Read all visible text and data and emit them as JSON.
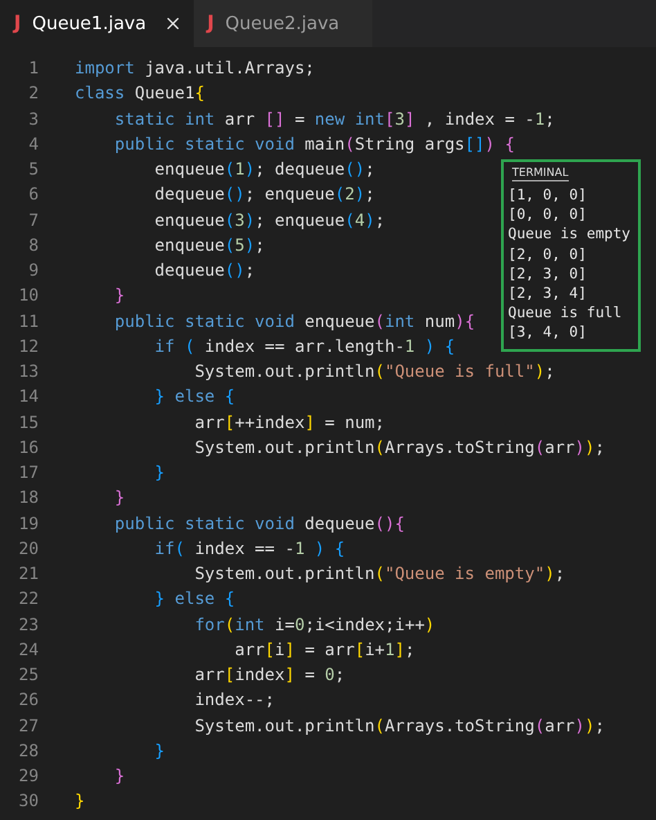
{
  "tabs": [
    {
      "badge": "J",
      "label": "Queue1.java",
      "selected": true
    },
    {
      "badge": "J",
      "label": "Queue2.java",
      "selected": false
    }
  ],
  "editor": {
    "lines": [
      {
        "number": "1",
        "tokens": [
          {
            "text": "import",
            "kind": "kw"
          },
          {
            "text": " java.util.Arrays;",
            "kind": "id"
          }
        ]
      },
      {
        "number": "2",
        "tokens": [
          {
            "text": "class",
            "kind": "kw"
          },
          {
            "text": " Queue1",
            "kind": "id"
          },
          {
            "text": "{",
            "kind": "b1"
          }
        ]
      },
      {
        "number": "3",
        "tokens": [
          {
            "text": "    static int",
            "kind": "kw"
          },
          {
            "text": " arr ",
            "kind": "id"
          },
          {
            "text": "[]",
            "kind": "b2"
          },
          {
            "text": " = ",
            "kind": "id"
          },
          {
            "text": "new int",
            "kind": "kw"
          },
          {
            "text": "[",
            "kind": "b2"
          },
          {
            "text": "3",
            "kind": "num"
          },
          {
            "text": "]",
            "kind": "b2"
          },
          {
            "text": " , index = -",
            "kind": "id"
          },
          {
            "text": "1",
            "kind": "num"
          },
          {
            "text": ";",
            "kind": "id"
          }
        ]
      },
      {
        "number": "4",
        "tokens": [
          {
            "text": "    public static void",
            "kind": "kw"
          },
          {
            "text": " main",
            "kind": "id"
          },
          {
            "text": "(",
            "kind": "b2"
          },
          {
            "text": "String args",
            "kind": "id"
          },
          {
            "text": "[]",
            "kind": "b3"
          },
          {
            "text": ")",
            "kind": "b2"
          },
          {
            "text": " {",
            "kind": "b2"
          }
        ]
      },
      {
        "number": "5",
        "tokens": [
          {
            "text": "        enqueue",
            "kind": "id"
          },
          {
            "text": "(",
            "kind": "b3"
          },
          {
            "text": "1",
            "kind": "num"
          },
          {
            "text": ")",
            "kind": "b3"
          },
          {
            "text": "; dequeue",
            "kind": "id"
          },
          {
            "text": "()",
            "kind": "b3"
          },
          {
            "text": ";",
            "kind": "id"
          }
        ]
      },
      {
        "number": "6",
        "tokens": [
          {
            "text": "        dequeue",
            "kind": "id"
          },
          {
            "text": "()",
            "kind": "b3"
          },
          {
            "text": "; enqueue",
            "kind": "id"
          },
          {
            "text": "(",
            "kind": "b3"
          },
          {
            "text": "2",
            "kind": "num"
          },
          {
            "text": ")",
            "kind": "b3"
          },
          {
            "text": ";",
            "kind": "id"
          }
        ]
      },
      {
        "number": "7",
        "tokens": [
          {
            "text": "        enqueue",
            "kind": "id"
          },
          {
            "text": "(",
            "kind": "b3"
          },
          {
            "text": "3",
            "kind": "num"
          },
          {
            "text": ")",
            "kind": "b3"
          },
          {
            "text": "; enqueue",
            "kind": "id"
          },
          {
            "text": "(",
            "kind": "b3"
          },
          {
            "text": "4",
            "kind": "num"
          },
          {
            "text": ")",
            "kind": "b3"
          },
          {
            "text": ";",
            "kind": "id"
          }
        ]
      },
      {
        "number": "8",
        "tokens": [
          {
            "text": "        enqueue",
            "kind": "id"
          },
          {
            "text": "(",
            "kind": "b3"
          },
          {
            "text": "5",
            "kind": "num"
          },
          {
            "text": ")",
            "kind": "b3"
          },
          {
            "text": ";",
            "kind": "id"
          }
        ]
      },
      {
        "number": "9",
        "tokens": [
          {
            "text": "        dequeue",
            "kind": "id"
          },
          {
            "text": "()",
            "kind": "b3"
          },
          {
            "text": ";",
            "kind": "id"
          }
        ]
      },
      {
        "number": "10",
        "tokens": [
          {
            "text": "    }",
            "kind": "b2"
          }
        ]
      },
      {
        "number": "11",
        "tokens": [
          {
            "text": "    public static void",
            "kind": "kw"
          },
          {
            "text": " enqueue",
            "kind": "id"
          },
          {
            "text": "(",
            "kind": "b2"
          },
          {
            "text": "int",
            "kind": "kw"
          },
          {
            "text": " num",
            "kind": "id"
          },
          {
            "text": ")",
            "kind": "b2"
          },
          {
            "text": "{",
            "kind": "b2"
          }
        ]
      },
      {
        "number": "12",
        "tokens": [
          {
            "text": "        if",
            "kind": "kw"
          },
          {
            "text": " (",
            "kind": "b3"
          },
          {
            "text": " index == arr.length-",
            "kind": "id"
          },
          {
            "text": "1",
            "kind": "num"
          },
          {
            "text": " )",
            "kind": "b3"
          },
          {
            "text": " {",
            "kind": "b3"
          }
        ]
      },
      {
        "number": "13",
        "tokens": [
          {
            "text": "            System.out.println",
            "kind": "id"
          },
          {
            "text": "(",
            "kind": "b1"
          },
          {
            "text": "\"Queue is full\"",
            "kind": "str"
          },
          {
            "text": ")",
            "kind": "b1"
          },
          {
            "text": ";",
            "kind": "id"
          }
        ]
      },
      {
        "number": "14",
        "tokens": [
          {
            "text": "        }",
            "kind": "b3"
          },
          {
            "text": " else",
            "kind": "kw"
          },
          {
            "text": " {",
            "kind": "b3"
          }
        ]
      },
      {
        "number": "15",
        "tokens": [
          {
            "text": "            arr",
            "kind": "id"
          },
          {
            "text": "[",
            "kind": "b1"
          },
          {
            "text": "++index",
            "kind": "id"
          },
          {
            "text": "]",
            "kind": "b1"
          },
          {
            "text": " = num;",
            "kind": "id"
          }
        ]
      },
      {
        "number": "16",
        "tokens": [
          {
            "text": "            System.out.println",
            "kind": "id"
          },
          {
            "text": "(",
            "kind": "b1"
          },
          {
            "text": "Arrays.toString",
            "kind": "id"
          },
          {
            "text": "(",
            "kind": "b2"
          },
          {
            "text": "arr",
            "kind": "id"
          },
          {
            "text": ")",
            "kind": "b2"
          },
          {
            "text": ")",
            "kind": "b1"
          },
          {
            "text": ";",
            "kind": "id"
          }
        ]
      },
      {
        "number": "17",
        "tokens": [
          {
            "text": "        }",
            "kind": "b3"
          }
        ]
      },
      {
        "number": "18",
        "tokens": [
          {
            "text": "    }",
            "kind": "b2"
          }
        ]
      },
      {
        "number": "19",
        "tokens": [
          {
            "text": "    public static void",
            "kind": "kw"
          },
          {
            "text": " dequeue",
            "kind": "id"
          },
          {
            "text": "()",
            "kind": "b2"
          },
          {
            "text": "{",
            "kind": "b2"
          }
        ]
      },
      {
        "number": "20",
        "tokens": [
          {
            "text": "        if",
            "kind": "kw"
          },
          {
            "text": "(",
            "kind": "b3"
          },
          {
            "text": " index == -",
            "kind": "id"
          },
          {
            "text": "1",
            "kind": "num"
          },
          {
            "text": " )",
            "kind": "b3"
          },
          {
            "text": " {",
            "kind": "b3"
          }
        ]
      },
      {
        "number": "21",
        "tokens": [
          {
            "text": "            System.out.println",
            "kind": "id"
          },
          {
            "text": "(",
            "kind": "b1"
          },
          {
            "text": "\"Queue is empty\"",
            "kind": "str"
          },
          {
            "text": ")",
            "kind": "b1"
          },
          {
            "text": ";",
            "kind": "id"
          }
        ]
      },
      {
        "number": "22",
        "tokens": [
          {
            "text": "        }",
            "kind": "b3"
          },
          {
            "text": " else",
            "kind": "kw"
          },
          {
            "text": " {",
            "kind": "b3"
          }
        ]
      },
      {
        "number": "23",
        "tokens": [
          {
            "text": "            for",
            "kind": "kw"
          },
          {
            "text": "(",
            "kind": "b1"
          },
          {
            "text": "int",
            "kind": "kw"
          },
          {
            "text": " i=",
            "kind": "id"
          },
          {
            "text": "0",
            "kind": "num"
          },
          {
            "text": ";i<index;i++",
            "kind": "id"
          },
          {
            "text": ")",
            "kind": "b1"
          }
        ]
      },
      {
        "number": "24",
        "tokens": [
          {
            "text": "                arr",
            "kind": "id"
          },
          {
            "text": "[",
            "kind": "b1"
          },
          {
            "text": "i",
            "kind": "id"
          },
          {
            "text": "]",
            "kind": "b1"
          },
          {
            "text": " = arr",
            "kind": "id"
          },
          {
            "text": "[",
            "kind": "b1"
          },
          {
            "text": "i+",
            "kind": "id"
          },
          {
            "text": "1",
            "kind": "num"
          },
          {
            "text": "]",
            "kind": "b1"
          },
          {
            "text": ";",
            "kind": "id"
          }
        ]
      },
      {
        "number": "25",
        "tokens": [
          {
            "text": "            arr",
            "kind": "id"
          },
          {
            "text": "[",
            "kind": "b1"
          },
          {
            "text": "index",
            "kind": "id"
          },
          {
            "text": "]",
            "kind": "b1"
          },
          {
            "text": " = ",
            "kind": "id"
          },
          {
            "text": "0",
            "kind": "num"
          },
          {
            "text": ";",
            "kind": "id"
          }
        ]
      },
      {
        "number": "26",
        "tokens": [
          {
            "text": "            index--;",
            "kind": "id"
          }
        ]
      },
      {
        "number": "27",
        "tokens": [
          {
            "text": "            System.out.println",
            "kind": "id"
          },
          {
            "text": "(",
            "kind": "b1"
          },
          {
            "text": "Arrays.toString",
            "kind": "id"
          },
          {
            "text": "(",
            "kind": "b2"
          },
          {
            "text": "arr",
            "kind": "id"
          },
          {
            "text": ")",
            "kind": "b2"
          },
          {
            "text": ")",
            "kind": "b1"
          },
          {
            "text": ";",
            "kind": "id"
          }
        ]
      },
      {
        "number": "28",
        "tokens": [
          {
            "text": "        }",
            "kind": "b3"
          }
        ]
      },
      {
        "number": "29",
        "tokens": [
          {
            "text": "    }",
            "kind": "b2"
          }
        ]
      },
      {
        "number": "30",
        "tokens": [
          {
            "text": "}",
            "kind": "b1"
          }
        ]
      }
    ]
  },
  "terminal": {
    "title": "TERMINAL",
    "lines": [
      "[1, 0, 0]",
      "[0, 0, 0]",
      "Queue is empty",
      "[2, 0, 0]",
      "[2, 3, 0]",
      "[2, 3, 4]",
      "Queue is full",
      "[3, 4, 0]"
    ]
  }
}
